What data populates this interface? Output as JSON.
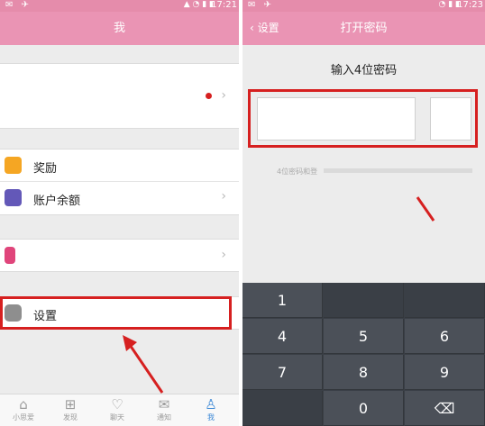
{
  "left": {
    "status": {
      "icons_left": "✉ ✈",
      "icons_right": "▲ ◔ ▮ ▮",
      "time": "17:21"
    },
    "title": "我",
    "menu": {
      "reward_label": "奖励",
      "balance_label": "账户余额",
      "settings_label": "设置"
    },
    "tabs": [
      {
        "label": "小思爱",
        "icon": "home-icon"
      },
      {
        "label": "发现",
        "icon": "grid-icon"
      },
      {
        "label": "聊天",
        "icon": "heart-icon"
      },
      {
        "label": "通知",
        "icon": "mail-icon"
      },
      {
        "label": "我",
        "icon": "person-icon"
      }
    ]
  },
  "right": {
    "status": {
      "icons_left": "✉ ✈",
      "icons_right": "◔ ▮ ▮",
      "time": "17:23"
    },
    "back_label": "设置",
    "title": "打开密码",
    "prompt": "输入4位密码",
    "hint": "4位密码和登",
    "keys": {
      "k1": "1",
      "k4": "4",
      "k5": "5",
      "k6": "6",
      "k7": "7",
      "k8": "8",
      "k9": "9",
      "k0": "0",
      "backspace": "⌫"
    }
  },
  "colors": {
    "header_pink": "#ea94b4",
    "accent_red": "#d62020",
    "tab_active": "#3d89d6",
    "keypad": "#3a3f46"
  }
}
